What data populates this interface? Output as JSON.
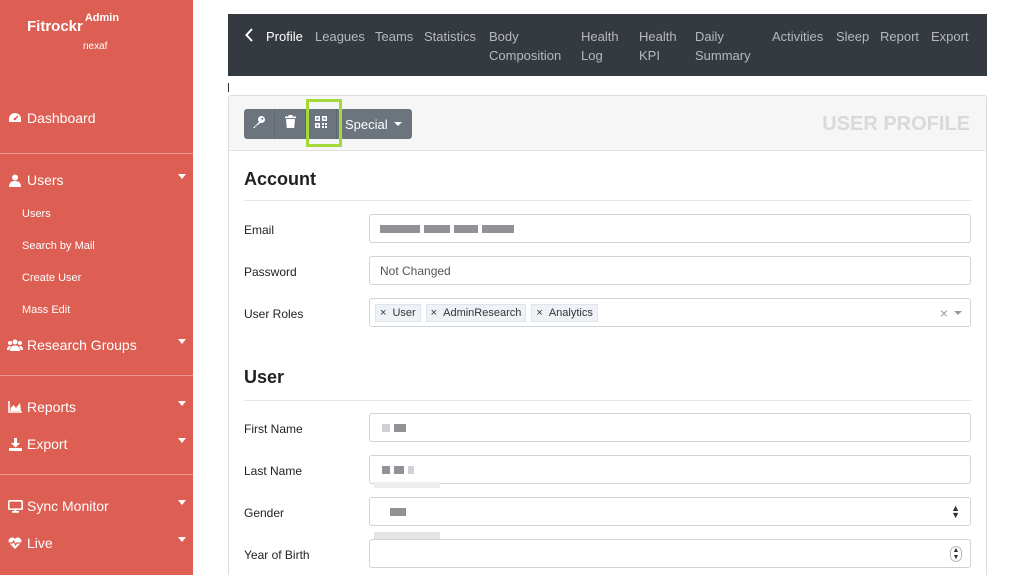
{
  "sidebar": {
    "brand": "Fitrockr",
    "brand_sup": "Admin",
    "subbrand": "nexaf",
    "items": [
      {
        "label": "Dashboard"
      },
      {
        "label": "Users"
      },
      {
        "label": "Research Groups"
      },
      {
        "label": "Reports"
      },
      {
        "label": "Export"
      },
      {
        "label": "Sync Monitor"
      },
      {
        "label": "Live"
      }
    ],
    "users_sub": [
      "Users",
      "Search by Mail",
      "Create User",
      "Mass Edit"
    ]
  },
  "topnav": {
    "tabs": [
      {
        "label": "Profile"
      },
      {
        "label": "Leagues"
      },
      {
        "label": "Teams"
      },
      {
        "label": "Statistics"
      },
      {
        "label": "Body Composition"
      },
      {
        "label": "Health Log"
      },
      {
        "label": "Health KPI"
      },
      {
        "label": "Daily Summary"
      },
      {
        "label": "Activities"
      },
      {
        "label": "Sleep"
      },
      {
        "label": "Report"
      },
      {
        "label": "Export"
      }
    ]
  },
  "card": {
    "title": "USER PROFILE",
    "special_label": "Special",
    "account_title": "Account",
    "user_title": "User",
    "fields": {
      "email_label": "Email",
      "password_label": "Password",
      "password_placeholder": "Not Changed",
      "roles_label": "User Roles",
      "roles": [
        "User",
        "AdminResearch",
        "Analytics"
      ],
      "first_name_label": "First Name",
      "last_name_label": "Last Name",
      "gender_label": "Gender",
      "yob_label": "Year of Birth"
    }
  },
  "colors": {
    "sidebar_bg": "#dd5e52",
    "topnav_bg": "#343a40",
    "button_bg": "#6c757d",
    "highlight": "#a3d93a"
  }
}
